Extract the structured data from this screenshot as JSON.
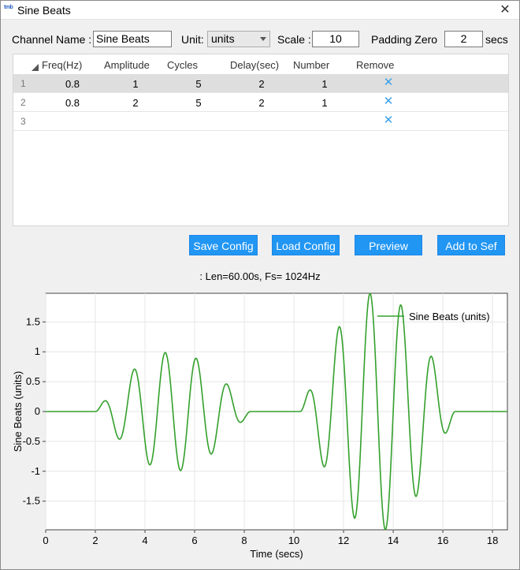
{
  "window": {
    "title": "Sine Beats",
    "icon": "app-icon",
    "icon_text": "tmb"
  },
  "form": {
    "channel_label": "Channel Name :",
    "channel_value": "Sine Beats",
    "unit_label": "Unit:",
    "unit_value": "units",
    "scale_label": "Scale :",
    "scale_value": "10",
    "padding_label": "Padding Zero",
    "padding_value": "2",
    "padding_unit": "secs"
  },
  "table": {
    "columns": [
      "Freq(Hz)",
      "Amplitude",
      "Cycles",
      "Delay(sec)",
      "Number",
      "Remove"
    ],
    "rows": [
      {
        "num": "1",
        "freq": "0.8",
        "amp": "1",
        "cycles": "5",
        "delay": "2",
        "number": "1",
        "selected": true
      },
      {
        "num": "2",
        "freq": "0.8",
        "amp": "2",
        "cycles": "5",
        "delay": "2",
        "number": "1",
        "selected": false
      },
      {
        "num": "3",
        "freq": "",
        "amp": "",
        "cycles": "",
        "delay": "",
        "number": "",
        "selected": false
      }
    ],
    "remove_glyph": "✕"
  },
  "buttons": {
    "save": "Save Config",
    "load": "Load Config",
    "preview": "Preview",
    "add": "Add to Sef"
  },
  "info_text": ": Len=60.00s, Fs= 1024Hz",
  "chart_data": {
    "type": "line",
    "xlabel": "Time (secs)",
    "ylabel": "Sine Beats (units)",
    "xlim": [
      0,
      18.6
    ],
    "ylim": [
      -1.98,
      1.98
    ],
    "xticks": [
      "0",
      "2",
      "4",
      "6",
      "8",
      "10",
      "12",
      "14",
      "16",
      "18"
    ],
    "yticks": [
      "1.5",
      "1",
      "0.5",
      "0",
      "-0.5",
      "-1",
      "-1.5"
    ],
    "grid": true,
    "legend_position": "top-right",
    "series": [
      {
        "name": "Sine Beats (units)",
        "color": "#33a02c",
        "bursts": [
          {
            "start": 2,
            "freq": 0.8,
            "amplitude": 1,
            "cycles": 5
          },
          {
            "start": 10.25,
            "freq": 0.8,
            "amplitude": 2,
            "cycles": 5
          }
        ]
      }
    ]
  }
}
